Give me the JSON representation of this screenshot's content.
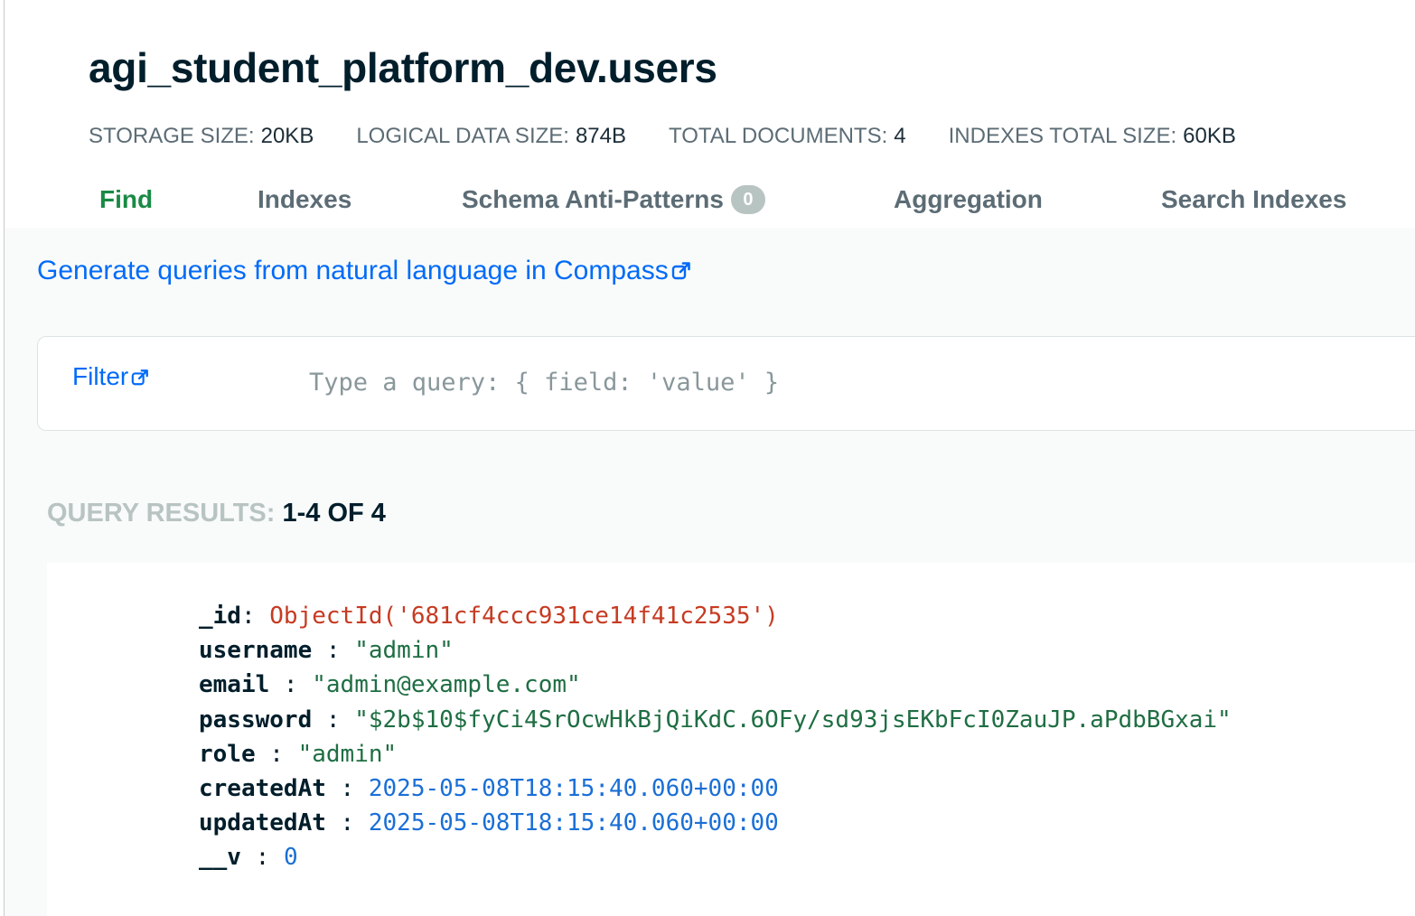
{
  "collection": {
    "title": "agi_student_platform_dev.users"
  },
  "stats": [
    {
      "label": "STORAGE SIZE:",
      "value": "20KB"
    },
    {
      "label": "LOGICAL DATA SIZE:",
      "value": "874B"
    },
    {
      "label": "TOTAL DOCUMENTS:",
      "value": "4"
    },
    {
      "label": "INDEXES TOTAL SIZE:",
      "value": "60KB"
    }
  ],
  "tabs": [
    {
      "label": "Find",
      "active": true
    },
    {
      "label": "Indexes"
    },
    {
      "label": "Schema Anti-Patterns",
      "badge": "0"
    },
    {
      "label": "Aggregation"
    },
    {
      "label": "Search Indexes"
    }
  ],
  "nl_link": "Generate queries from natural language in Compass",
  "filter": {
    "label": "Filter",
    "placeholder": "Type a query: { field: 'value' }"
  },
  "results": {
    "label": "QUERY RESULTS:",
    "range": "1-4 OF 4"
  },
  "document": {
    "fields": [
      {
        "key": "_id",
        "sep": ": ",
        "value": "ObjectId('681cf4ccc931ce14f41c2535')",
        "type": "oid"
      },
      {
        "key": "username",
        "sep": " : ",
        "value": "\"admin\"",
        "type": "str"
      },
      {
        "key": "email",
        "sep": " : ",
        "value": "\"admin@example.com\"",
        "type": "str"
      },
      {
        "key": "password",
        "sep": " : ",
        "value": "\"$2b$10$fyCi4SrOcwHkBjQiKdC.6OFy/sd93jsEKbFcI0ZauJP.aPdbBGxai\"",
        "type": "str"
      },
      {
        "key": "role",
        "sep": " : ",
        "value": "\"admin\"",
        "type": "str"
      },
      {
        "key": "createdAt",
        "sep": " : ",
        "value": "2025-05-08T18:15:40.060+00:00",
        "type": "date"
      },
      {
        "key": "updatedAt",
        "sep": " : ",
        "value": "2025-05-08T18:15:40.060+00:00",
        "type": "date"
      },
      {
        "key": "__v",
        "sep": " : ",
        "value": "0",
        "type": "num"
      }
    ]
  },
  "colors": {
    "accent_green": "#1a8a45",
    "link_blue": "#016bf8",
    "oid_red": "#c63b22",
    "string_green": "#1f6e43",
    "date_blue": "#1a6fd6"
  },
  "icons": {
    "external_link": "external-link-icon"
  }
}
